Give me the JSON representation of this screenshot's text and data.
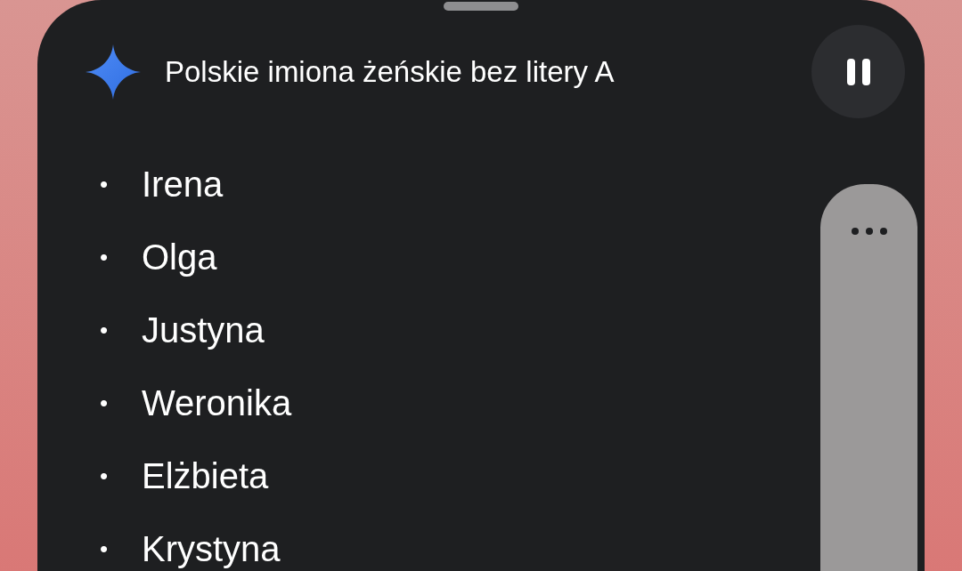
{
  "title": "Polskie imiona żeńskie bez litery A",
  "playing": true,
  "items": [
    {
      "bullet": "•",
      "text": "Irena"
    },
    {
      "bullet": "•",
      "text": "Olga"
    },
    {
      "bullet": "•",
      "text": "Justyna"
    },
    {
      "bullet": "•",
      "text": "Weronika"
    },
    {
      "bullet": "•",
      "text": "Elżbieta"
    },
    {
      "bullet": "•",
      "text": "Krystyna"
    }
  ]
}
